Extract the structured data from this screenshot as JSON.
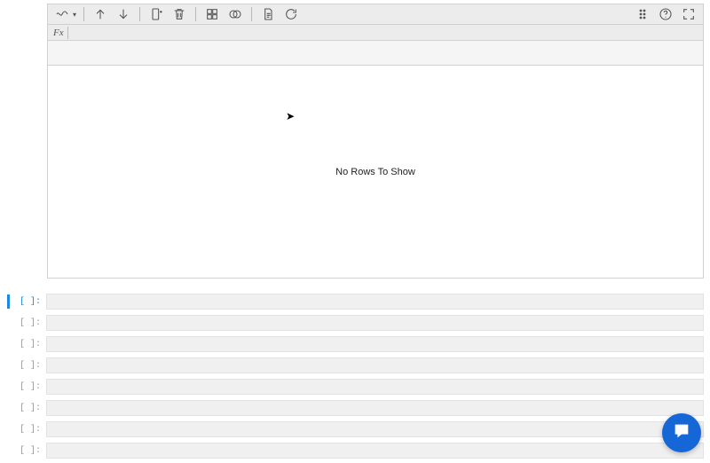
{
  "toolbar": {
    "icons": {
      "wave": "wave-icon",
      "up": "arrow-up-icon",
      "down": "arrow-down-icon",
      "add_col": "add-column-icon",
      "trash": "trash-icon",
      "qr": "grid-icon",
      "venn": "venn-icon",
      "page": "page-icon",
      "refresh": "refresh-icon",
      "handle": "drag-handle-icon",
      "help": "help-icon",
      "expand": "expand-icon"
    }
  },
  "fx": {
    "label": "Fx",
    "value": ""
  },
  "grid": {
    "empty_message": "No Rows To Show"
  },
  "cells": [
    {
      "prompt": "[ ]:",
      "active": true
    },
    {
      "prompt": "[ ]:",
      "active": false
    },
    {
      "prompt": "[ ]:",
      "active": false
    },
    {
      "prompt": "[ ]:",
      "active": false
    },
    {
      "prompt": "[ ]:",
      "active": false
    },
    {
      "prompt": "[ ]:",
      "active": false
    },
    {
      "prompt": "[ ]:",
      "active": false
    },
    {
      "prompt": "[ ]:",
      "active": false
    }
  ]
}
